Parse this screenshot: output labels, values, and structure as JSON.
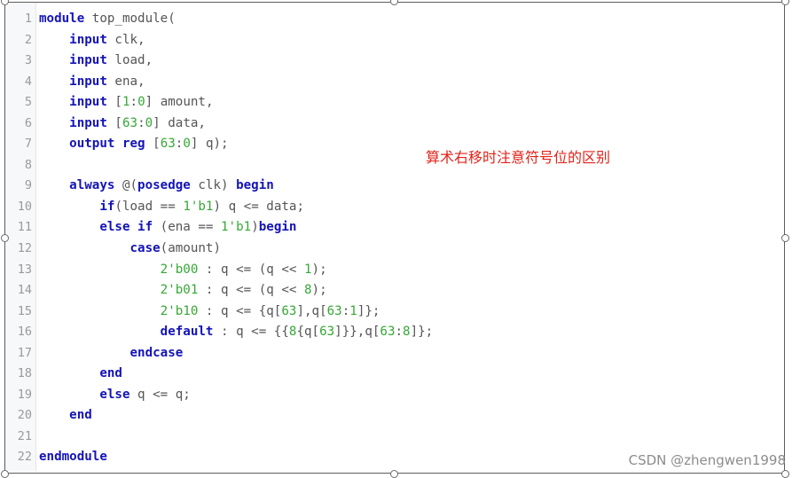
{
  "code_lines": [
    [
      {
        "t": "module",
        "c": "kw"
      },
      {
        "t": " top_module(",
        "c": "p"
      }
    ],
    [
      {
        "t": "    ",
        "c": "p"
      },
      {
        "t": "input",
        "c": "kw"
      },
      {
        "t": " clk,",
        "c": "p"
      }
    ],
    [
      {
        "t": "    ",
        "c": "p"
      },
      {
        "t": "input",
        "c": "kw"
      },
      {
        "t": " load,",
        "c": "p"
      }
    ],
    [
      {
        "t": "    ",
        "c": "p"
      },
      {
        "t": "input",
        "c": "kw"
      },
      {
        "t": " ena,",
        "c": "p"
      }
    ],
    [
      {
        "t": "    ",
        "c": "p"
      },
      {
        "t": "input",
        "c": "kw"
      },
      {
        "t": " [",
        "c": "p"
      },
      {
        "t": "1",
        "c": "num"
      },
      {
        "t": ":",
        "c": "p"
      },
      {
        "t": "0",
        "c": "num"
      },
      {
        "t": "] amount,",
        "c": "p"
      }
    ],
    [
      {
        "t": "    ",
        "c": "p"
      },
      {
        "t": "input",
        "c": "kw"
      },
      {
        "t": " [",
        "c": "p"
      },
      {
        "t": "63",
        "c": "num"
      },
      {
        "t": ":",
        "c": "p"
      },
      {
        "t": "0",
        "c": "num"
      },
      {
        "t": "] data,",
        "c": "p"
      }
    ],
    [
      {
        "t": "    ",
        "c": "p"
      },
      {
        "t": "output",
        "c": "kw"
      },
      {
        "t": " ",
        "c": "p"
      },
      {
        "t": "reg",
        "c": "kw"
      },
      {
        "t": " [",
        "c": "p"
      },
      {
        "t": "63",
        "c": "num"
      },
      {
        "t": ":",
        "c": "p"
      },
      {
        "t": "0",
        "c": "num"
      },
      {
        "t": "] q);",
        "c": "p"
      }
    ],
    [],
    [
      {
        "t": "    ",
        "c": "p"
      },
      {
        "t": "always",
        "c": "kw"
      },
      {
        "t": " @(",
        "c": "p"
      },
      {
        "t": "posedge",
        "c": "kw"
      },
      {
        "t": " clk) ",
        "c": "p"
      },
      {
        "t": "begin",
        "c": "kw"
      }
    ],
    [
      {
        "t": "        ",
        "c": "p"
      },
      {
        "t": "if",
        "c": "kw"
      },
      {
        "t": "(load == ",
        "c": "p"
      },
      {
        "t": "1'b1",
        "c": "num"
      },
      {
        "t": ") q <= data;",
        "c": "p"
      }
    ],
    [
      {
        "t": "        ",
        "c": "p"
      },
      {
        "t": "else if",
        "c": "kw"
      },
      {
        "t": " (ena == ",
        "c": "p"
      },
      {
        "t": "1'b1",
        "c": "num"
      },
      {
        "t": ")",
        "c": "p"
      },
      {
        "t": "begin",
        "c": "kw"
      }
    ],
    [
      {
        "t": "            ",
        "c": "p"
      },
      {
        "t": "case",
        "c": "kw"
      },
      {
        "t": "(amount)",
        "c": "p"
      }
    ],
    [
      {
        "t": "                ",
        "c": "p"
      },
      {
        "t": "2'b00",
        "c": "num"
      },
      {
        "t": " : q <= (q << ",
        "c": "p"
      },
      {
        "t": "1",
        "c": "num"
      },
      {
        "t": ");",
        "c": "p"
      }
    ],
    [
      {
        "t": "                ",
        "c": "p"
      },
      {
        "t": "2'b01",
        "c": "num"
      },
      {
        "t": " : q <= (q << ",
        "c": "p"
      },
      {
        "t": "8",
        "c": "num"
      },
      {
        "t": ");",
        "c": "p"
      }
    ],
    [
      {
        "t": "                ",
        "c": "p"
      },
      {
        "t": "2'b10",
        "c": "num"
      },
      {
        "t": " : q <= {q[",
        "c": "p"
      },
      {
        "t": "63",
        "c": "num"
      },
      {
        "t": "],q[",
        "c": "p"
      },
      {
        "t": "63",
        "c": "num"
      },
      {
        "t": ":",
        "c": "p"
      },
      {
        "t": "1",
        "c": "num"
      },
      {
        "t": "]};",
        "c": "p"
      }
    ],
    [
      {
        "t": "                ",
        "c": "p"
      },
      {
        "t": "default",
        "c": "kw"
      },
      {
        "t": " : q <= {{",
        "c": "p"
      },
      {
        "t": "8",
        "c": "num"
      },
      {
        "t": "{q[",
        "c": "p"
      },
      {
        "t": "63",
        "c": "num"
      },
      {
        "t": "]}},q[",
        "c": "p"
      },
      {
        "t": "63",
        "c": "num"
      },
      {
        "t": ":",
        "c": "p"
      },
      {
        "t": "8",
        "c": "num"
      },
      {
        "t": "]};",
        "c": "p"
      }
    ],
    [
      {
        "t": "            ",
        "c": "p"
      },
      {
        "t": "endcase",
        "c": "kw"
      }
    ],
    [
      {
        "t": "        ",
        "c": "p"
      },
      {
        "t": "end",
        "c": "kw"
      }
    ],
    [
      {
        "t": "        ",
        "c": "p"
      },
      {
        "t": "else",
        "c": "kw"
      },
      {
        "t": " q <= q;",
        "c": "p"
      }
    ],
    [
      {
        "t": "    ",
        "c": "p"
      },
      {
        "t": "end",
        "c": "kw"
      }
    ],
    [],
    [
      {
        "t": "endmodule",
        "c": "kw"
      }
    ]
  ],
  "annotation": "算术右移时注意符号位的区别",
  "watermark": "CSDN @zhengwen1998",
  "colors": {
    "keyword": "#1414b8",
    "number": "#36a836",
    "plain": "#555555",
    "line_number": "#9a9a9a",
    "annotation": "#e2231a"
  }
}
